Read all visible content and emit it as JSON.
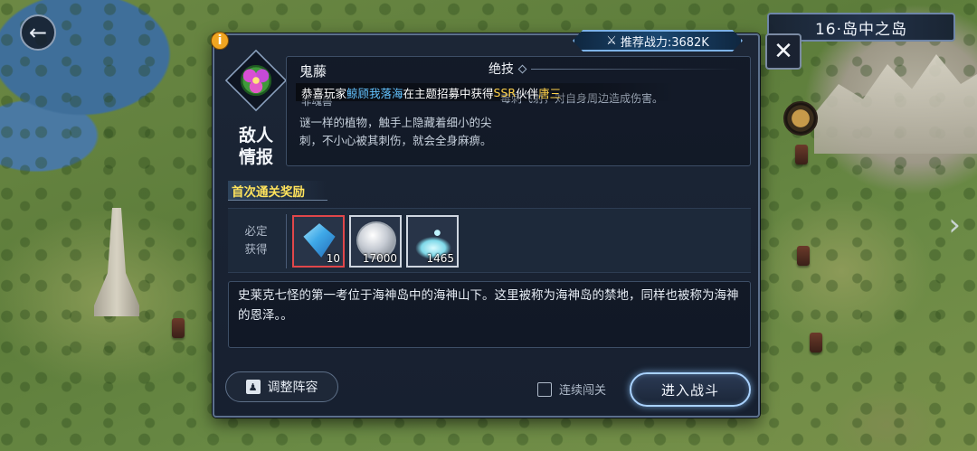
{
  "hud": {
    "back_icon": "back-arrow-icon",
    "back_glyph": "←",
    "stage_title": "16·岛中之岛",
    "next_arrow_glyph": "›"
  },
  "dialog": {
    "info_glyph": "i",
    "recommended_power": "推荐战力:3682K",
    "close_glyph": "✕",
    "enemy": {
      "name": "鬼藤",
      "type": "非魂兽",
      "info_title": "敌人情报",
      "description": "谜一样的植物，触手上隐藏着细小的尖刺，不小心被其刺伤，就会全身麻痹。"
    },
    "skill": {
      "header": "绝技",
      "description": "毒刺飞射，对自身周边造成伤害。"
    },
    "ticker": {
      "prefix": "恭喜玩家",
      "user": "鲸顾我落海",
      "middle": "在主题招募中获得",
      "rarity": "SSR",
      "partner_word": "伙伴",
      "hero": "唐三"
    },
    "rewards": {
      "title": "首次通关奖励",
      "guarantee_label": "必定获得",
      "items": [
        {
          "icon": "diamond-icon",
          "quantity": "10"
        },
        {
          "icon": "silver-coin-icon",
          "quantity": "17000"
        },
        {
          "icon": "crystal-dust-icon",
          "quantity": "1465"
        }
      ]
    },
    "lore": "史莱克七怪的第一考位于海神岛中的海神山下。这里被称为海神岛的禁地，同样也被称为海神的恩泽。。",
    "buttons": {
      "adjust_lineup": "调整阵容",
      "auto_clear": "连续闯关",
      "enter_battle": "进入战斗"
    }
  },
  "colors": {
    "accent_yellow": "#ffe35c",
    "highlight_blue": "#63c3ff",
    "dialog_bg": "#1c2636",
    "battle_glow": "#a9d2ff"
  }
}
